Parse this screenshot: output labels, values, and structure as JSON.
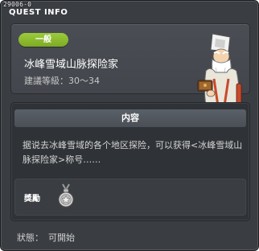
{
  "window": {
    "quest_id": "29006-0",
    "title": "QUEST INFO"
  },
  "info": {
    "category_badge": "一般",
    "quest_name": "冰峰雪域山脉探险家",
    "recommended_level_label": "建議等級：",
    "recommended_level_value": "30～34"
  },
  "content": {
    "header": "内容",
    "description": "据说去冰峰雪域的各个地区探险，可以获得<冰峰雪域山脉探险家>称号……",
    "reward_label": "獎勵"
  },
  "status": {
    "label": "狀態：",
    "value": "可開始"
  },
  "colors": {
    "window_bg": "#3a3d42",
    "badge_green": "#8dbb30",
    "text_primary": "#ffffff",
    "text_secondary": "#c8c8c8"
  },
  "icons": {
    "npc": "sage-npc-portrait",
    "reward": "medal-icon"
  }
}
